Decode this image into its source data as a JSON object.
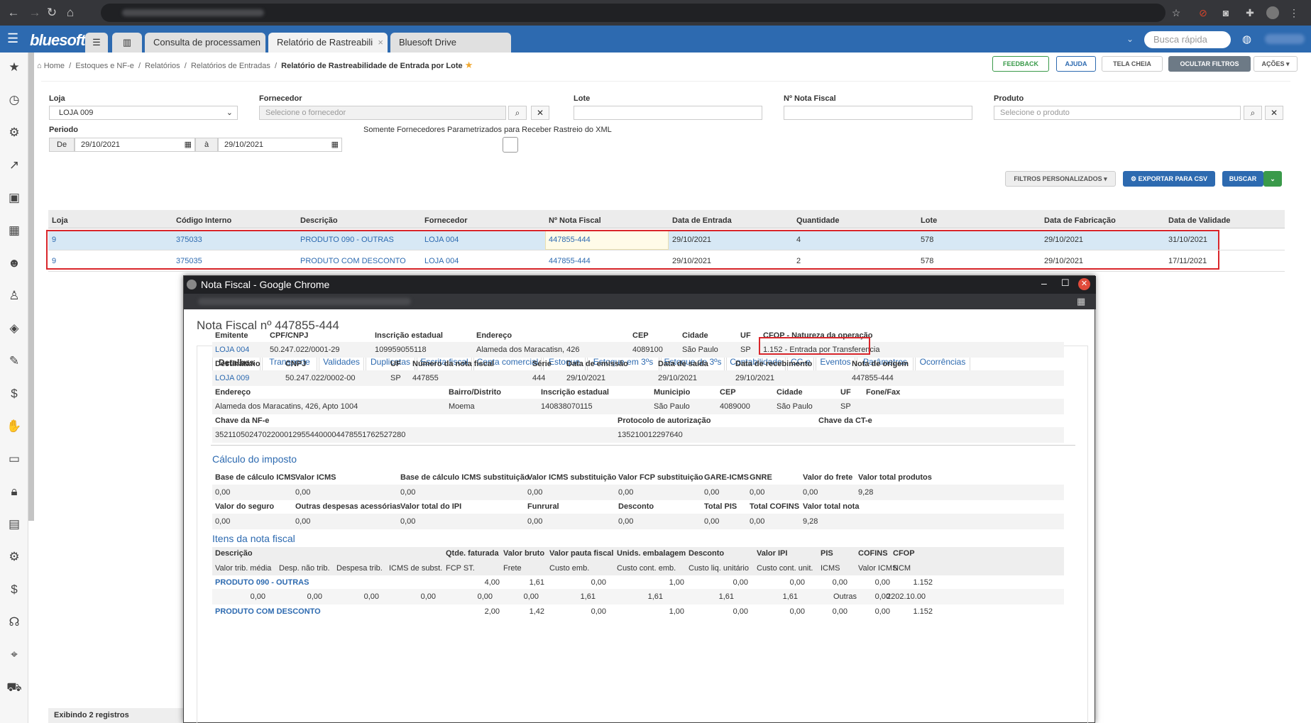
{
  "chrome": {
    "tab_title": "Nota Fiscal - Google Chrome"
  },
  "app": {
    "logo": "bluesoft",
    "tabs": [
      "Consulta de processamen",
      "Relatório de Rastreabili",
      "Bluesoft Drive"
    ],
    "quick_search_placeholder": "Busca rápida"
  },
  "breadcrumb": {
    "home": "Home",
    "items": [
      "Estoques e NF-e",
      "Relatórios",
      "Relatórios de Entradas"
    ],
    "current": "Relatório de Rastreabilidade de Entrada por Lote"
  },
  "toolbar": {
    "feedback": "FEEDBACK",
    "help": "AJUDA",
    "fullscreen": "TELA CHEIA",
    "hide_filters": "OCULTAR FILTROS",
    "actions": "AÇÕES"
  },
  "filters": {
    "loja_label": "Loja",
    "loja_value": "LOJA 009",
    "fornecedor_label": "Fornecedor",
    "fornecedor_ph": "Selecione o fornecedor",
    "lote_label": "Lote",
    "nf_label": "Nº Nota Fiscal",
    "produto_label": "Produto",
    "produto_ph": "Selecione o produto",
    "periodo_label": "Periodo",
    "de": "De",
    "date_from": "29/10/2021",
    "a": "à",
    "date_to": "29/10/2021",
    "somente_label": "Somente Fornecedores Parametrizados para Receber Rastreio do XML",
    "custom": "FILTROS PERSONALIZADOS",
    "export": "EXPORTAR PARA CSV",
    "search": "BUSCAR"
  },
  "grid": {
    "headers": [
      "Loja",
      "Código Interno",
      "Descrição",
      "Fornecedor",
      "Nº Nota Fiscal",
      "Data de Entrada",
      "Quantidade",
      "Lote",
      "Data de Fabricação",
      "Data de Validade"
    ],
    "rows": [
      [
        "9",
        "375033",
        "PRODUTO 090 - OUTRAS",
        "LOJA 004",
        "447855-444",
        "29/10/2021",
        "4",
        "578",
        "29/10/2021",
        "31/10/2021"
      ],
      [
        "9",
        "375035",
        "PRODUTO COM DESCONTO",
        "LOJA 004",
        "447855-444",
        "29/10/2021",
        "2",
        "578",
        "29/10/2021",
        "17/11/2021"
      ]
    ],
    "footer": "Exibindo 2 registros"
  },
  "popup": {
    "window_title": "Nota Fiscal - Google Chrome",
    "title": "Nota Fiscal nº 447855-444",
    "tabs": [
      "Detalhes",
      "Transporte",
      "Validades",
      "Duplicatas",
      "Escrita fiscal",
      "Conta comercial",
      "Estoque",
      "Estoque em 3ºs",
      "Estoque de 3ºs",
      "Contabilidade",
      "CC-e",
      "Eventos",
      "Parâmetros",
      "Ocorrências"
    ],
    "emit": {
      "l": [
        "Emitente",
        "CPF/CNPJ",
        "Inscrição estadual",
        "Endereço",
        "CEP",
        "Cidade",
        "UF",
        "CFOP - Natureza da operação"
      ],
      "v": [
        "LOJA 004",
        "50.247.022/0001-29",
        "109959055118",
        "Alameda dos Maracatisn, 426",
        "4089100",
        "São Paulo",
        "SP",
        "1.152 - Entrada por Transferencia"
      ]
    },
    "dest": {
      "l": [
        "Destinatário",
        "CNPJ",
        "UF",
        "Número da nota fiscal",
        "Série",
        "Data de emissão",
        "Data de saída",
        "Data de recebimento",
        "Nota de origem"
      ],
      "v": [
        "LOJA 009",
        "50.247.022/0002-00",
        "SP",
        "447855",
        "444",
        "29/10/2021",
        "29/10/2021",
        "29/10/2021",
        "447855-444"
      ]
    },
    "addr": {
      "l": [
        "Endereço",
        "Bairro/Distrito",
        "Inscrição estadual",
        "Municipio",
        "CEP",
        "Cidade",
        "UF",
        "Fone/Fax"
      ],
      "v": [
        "Alameda dos Maracatins, 426, Apto 1004",
        "Moema",
        "140838070115",
        "São Paulo",
        "4089000",
        "São Paulo",
        "SP",
        ""
      ]
    },
    "chave": {
      "l": [
        "Chave da NF-e",
        "Protocolo de autorização",
        "Chave da CT-e"
      ],
      "v": [
        "35211050247022000129554400004478551762527280",
        "135210012297640",
        ""
      ]
    },
    "calc_title": "Cálculo do imposto",
    "calc1": {
      "l": [
        "Base de cálculo ICMS",
        "Valor ICMS",
        "Base de cálculo ICMS substituição",
        "Valor ICMS substituição",
        "Valor FCP substituição",
        "GARE-ICMS",
        "GNRE",
        "Valor do frete",
        "Valor total produtos"
      ],
      "v": [
        "0,00",
        "0,00",
        "0,00",
        "0,00",
        "0,00",
        "0,00",
        "0,00",
        "0,00",
        "9,28"
      ]
    },
    "calc2": {
      "l": [
        "Valor do seguro",
        "Outras despesas acessórias",
        "Valor total do IPI",
        "Funrural",
        "Desconto",
        "Total PIS",
        "Total COFINS",
        "Valor total nota"
      ],
      "v": [
        "0,00",
        "0,00",
        "0,00",
        "0,00",
        "0,00",
        "0,00",
        "0,00",
        "9,28"
      ]
    },
    "items_title": "Itens da nota fiscal",
    "ih1": [
      "Descrição",
      "Qtde. faturada",
      "Valor bruto",
      "Valor pauta fiscal",
      "Unids. embalagem",
      "Desconto",
      "Valor IPI",
      "PIS",
      "COFINS",
      "CFOP"
    ],
    "ih2": [
      "Valor trib. média",
      "Desp. não trib.",
      "Despesa trib.",
      "ICMS de subst.",
      "FCP ST.",
      "Frete",
      "Custo emb.",
      "Custo cont. emb.",
      "Custo liq. unitário",
      "Custo cont. unit.",
      "ICMS",
      "Valor ICMS",
      "NCM"
    ],
    "item1a": [
      "PRODUTO 090 - OUTRAS",
      "4,00",
      "1,61",
      "0,00",
      "1,00",
      "0,00",
      "0,00",
      "0,00",
      "0,00",
      "1.152"
    ],
    "item1b": [
      "0,00",
      "0,00",
      "0,00",
      "0,00",
      "0,00",
      "0,00",
      "1,61",
      "1,61",
      "1,61",
      "1,61",
      "Outras",
      "0,00",
      "2202.10.00"
    ],
    "item2a": [
      "PRODUTO COM DESCONTO",
      "2,00",
      "1,42",
      "0,00",
      "1,00",
      "0,00",
      "0,00",
      "0,00",
      "0,00",
      "1.152"
    ]
  }
}
